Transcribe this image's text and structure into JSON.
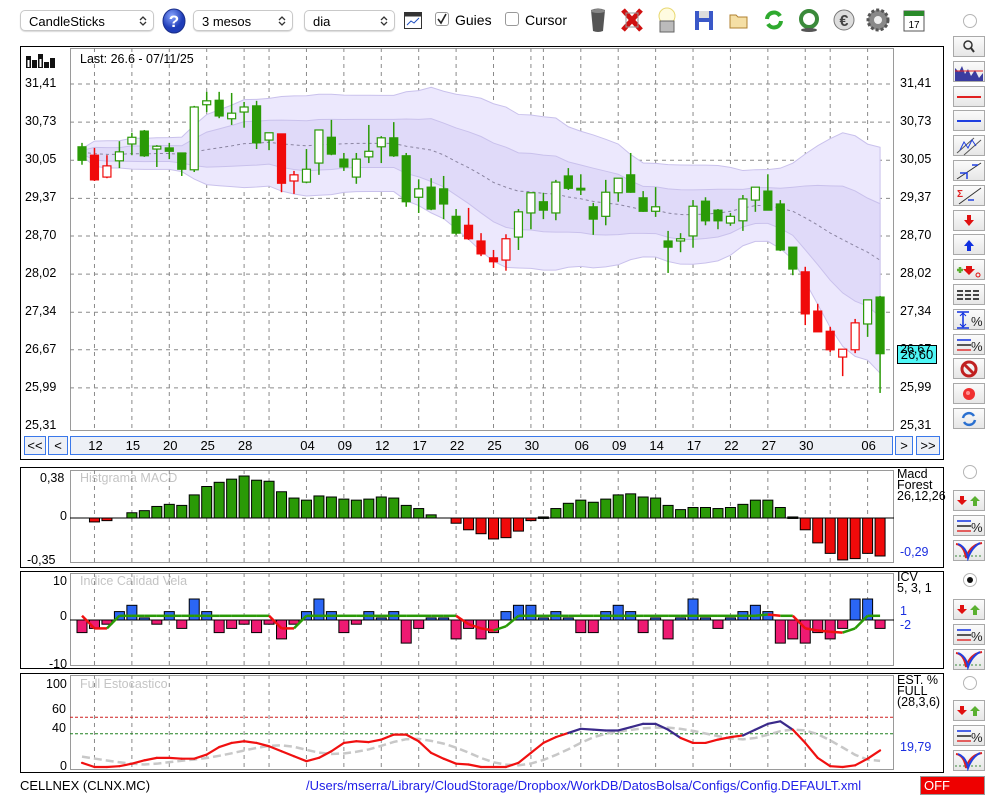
{
  "toolbar": {
    "chart_type": "CandleSticks",
    "period": "3 mesos",
    "interval": "dia",
    "guides_label": "Guies",
    "guides_checked": true,
    "cursor_label": "Cursor",
    "cursor_checked": false,
    "icons": [
      "trash-icon",
      "delete-x-icon",
      "lamp-icon",
      "save-icon",
      "folder-open-icon",
      "refresh-icon",
      "recycle-icon",
      "euro-icon",
      "gear-icon",
      "calendar-icon"
    ],
    "calendar_day": "17"
  },
  "main": {
    "last_label": "Last: 26.6 - 07/11/25",
    "price_labels": [
      "31,41",
      "30,73",
      "30,05",
      "29,37",
      "28,70",
      "28,02",
      "27,34",
      "26,67",
      "25,99",
      "25,31"
    ],
    "price_values": [
      31.41,
      30.73,
      30.05,
      29.37,
      28.7,
      28.02,
      27.34,
      26.67,
      25.99,
      25.31
    ],
    "current_price": "26,60",
    "current_price_value": 26.6,
    "current_price_color": "#4ff7f7",
    "nav": {
      "first": "<<",
      "prev": "<",
      "next": ">",
      "last": ">>"
    },
    "date_ticks": [
      {
        "i": 1,
        "label": "12"
      },
      {
        "i": 4,
        "label": "15"
      },
      {
        "i": 7,
        "label": "20"
      },
      {
        "i": 10,
        "label": "25"
      },
      {
        "i": 13,
        "label": "28"
      },
      {
        "i": 18,
        "label": "04"
      },
      {
        "i": 21,
        "label": "09"
      },
      {
        "i": 24,
        "label": "12"
      },
      {
        "i": 27,
        "label": "17"
      },
      {
        "i": 30,
        "label": "22"
      },
      {
        "i": 33,
        "label": "25"
      },
      {
        "i": 36,
        "label": "30"
      },
      {
        "i": 40,
        "label": "06"
      },
      {
        "i": 43,
        "label": "09"
      },
      {
        "i": 46,
        "label": "14"
      },
      {
        "i": 49,
        "label": "17"
      },
      {
        "i": 52,
        "label": "22"
      },
      {
        "i": 55,
        "label": "27"
      },
      {
        "i": 58,
        "label": "30"
      },
      {
        "i": 63,
        "label": "06"
      }
    ],
    "month_starts": [
      15,
      37,
      60
    ]
  },
  "chart_data": [
    {
      "type": "candlestick",
      "title": "CELLNEX (CLNX.MC)",
      "ylim": [
        25.31,
        31.41
      ],
      "up_color": "#2a9a06",
      "down_color": "#f00a0a",
      "candles_ohlc_color": [
        [
          30.29,
          30.36,
          29.97,
          30.05,
          "g"
        ],
        [
          30.14,
          30.27,
          29.68,
          29.7,
          "r"
        ],
        [
          29.75,
          30.14,
          29.73,
          29.95,
          "r"
        ],
        [
          30.04,
          30.39,
          29.91,
          30.2,
          "g"
        ],
        [
          30.34,
          30.54,
          30.14,
          30.46,
          "g"
        ],
        [
          30.57,
          30.59,
          30.11,
          30.13,
          "g"
        ],
        [
          30.25,
          30.32,
          29.93,
          30.3,
          "g"
        ],
        [
          30.27,
          30.36,
          30.07,
          30.21,
          "g"
        ],
        [
          30.18,
          30.18,
          29.77,
          29.89,
          "g"
        ],
        [
          29.88,
          31.02,
          29.84,
          31.0,
          "g"
        ],
        [
          31.04,
          31.27,
          30.91,
          31.11,
          "g"
        ],
        [
          31.12,
          31.27,
          30.8,
          30.84,
          "g"
        ],
        [
          30.79,
          31.25,
          30.68,
          30.89,
          "g"
        ],
        [
          30.91,
          31.09,
          30.63,
          31.0,
          "g"
        ],
        [
          31.02,
          31.11,
          30.25,
          30.36,
          "g"
        ],
        [
          30.41,
          30.54,
          30.23,
          30.54,
          "g"
        ],
        [
          30.52,
          30.52,
          29.48,
          29.64,
          "r"
        ],
        [
          29.68,
          29.86,
          29.45,
          29.79,
          "r"
        ],
        [
          29.66,
          30.25,
          29.64,
          29.89,
          "g"
        ],
        [
          30.0,
          30.59,
          29.79,
          30.59,
          "g"
        ],
        [
          30.46,
          30.77,
          30.14,
          30.16,
          "g"
        ],
        [
          30.07,
          30.18,
          29.86,
          29.93,
          "g"
        ],
        [
          29.75,
          30.18,
          29.63,
          30.07,
          "g"
        ],
        [
          30.11,
          30.68,
          30.0,
          30.21,
          "g"
        ],
        [
          30.29,
          30.48,
          30.0,
          30.45,
          "g"
        ],
        [
          30.45,
          30.73,
          30.11,
          30.13,
          "g"
        ],
        [
          30.13,
          30.18,
          29.22,
          29.31,
          "g"
        ],
        [
          29.39,
          29.71,
          29.11,
          29.54,
          "g"
        ],
        [
          29.57,
          29.73,
          29.16,
          29.18,
          "g"
        ],
        [
          29.54,
          29.77,
          29.0,
          29.27,
          "g"
        ],
        [
          29.05,
          29.18,
          28.72,
          28.75,
          "g"
        ],
        [
          28.89,
          29.2,
          28.63,
          28.65,
          "r"
        ],
        [
          28.61,
          28.75,
          28.34,
          28.38,
          "r"
        ],
        [
          28.31,
          28.45,
          28.13,
          28.24,
          "r"
        ],
        [
          28.27,
          28.73,
          28.08,
          28.65,
          "r"
        ],
        [
          28.68,
          29.18,
          28.45,
          29.13,
          "g"
        ],
        [
          29.11,
          29.47,
          28.82,
          29.47,
          "g"
        ],
        [
          29.31,
          29.47,
          29.0,
          29.16,
          "g"
        ],
        [
          29.11,
          29.7,
          28.98,
          29.66,
          "g"
        ],
        [
          29.77,
          29.91,
          29.52,
          29.55,
          "g"
        ],
        [
          29.55,
          29.8,
          29.43,
          29.52,
          "g"
        ],
        [
          29.22,
          29.29,
          28.72,
          29.0,
          "g"
        ],
        [
          29.05,
          29.7,
          28.89,
          29.48,
          "g"
        ],
        [
          29.47,
          29.73,
          29.31,
          29.73,
          "g"
        ],
        [
          29.79,
          30.18,
          29.47,
          29.48,
          "g"
        ],
        [
          29.38,
          29.5,
          29.13,
          29.14,
          "g"
        ],
        [
          29.14,
          29.57,
          29.04,
          29.22,
          "g"
        ],
        [
          28.61,
          28.79,
          28.04,
          28.5,
          "g"
        ],
        [
          28.61,
          28.75,
          28.41,
          28.65,
          "g"
        ],
        [
          28.7,
          29.34,
          28.49,
          29.23,
          "g"
        ],
        [
          29.32,
          29.39,
          28.89,
          28.97,
          "g"
        ],
        [
          29.16,
          29.18,
          28.82,
          28.97,
          "g"
        ],
        [
          28.93,
          29.11,
          28.88,
          29.05,
          "g"
        ],
        [
          28.97,
          29.43,
          28.79,
          29.36,
          "g"
        ],
        [
          29.34,
          29.57,
          29.13,
          29.57,
          "g"
        ],
        [
          29.5,
          29.8,
          29.16,
          29.16,
          "g"
        ],
        [
          29.27,
          29.34,
          28.43,
          28.45,
          "g"
        ],
        [
          28.5,
          28.5,
          28.0,
          28.11,
          "g"
        ],
        [
          28.06,
          28.15,
          27.11,
          27.31,
          "r"
        ],
        [
          27.36,
          27.49,
          26.99,
          26.99,
          "r"
        ],
        [
          27.0,
          27.08,
          26.63,
          26.67,
          "r"
        ],
        [
          26.54,
          26.68,
          26.2,
          26.68,
          "r"
        ],
        [
          26.67,
          27.22,
          26.61,
          27.15,
          "r"
        ],
        [
          27.13,
          27.56,
          26.9,
          27.56,
          "g"
        ],
        [
          27.61,
          27.63,
          25.9,
          26.6,
          "g"
        ]
      ]
    },
    {
      "type": "bar",
      "title": "Histgrama MACD",
      "axis_labels": [
        "0,38",
        "0",
        "-0,35"
      ],
      "legend": [
        "Macd",
        "Forest",
        "26,12,26"
      ],
      "last_value": "-0,29",
      "pos_color": "#2a9a06",
      "neg_color": "#f00a0a",
      "values": [
        0,
        -0.03,
        -0.02,
        0,
        0.05,
        0.07,
        0.11,
        0.13,
        0.12,
        0.22,
        0.3,
        0.34,
        0.37,
        0.4,
        0.36,
        0.35,
        0.25,
        0.19,
        0.17,
        0.21,
        0.2,
        0.18,
        0.17,
        0.18,
        0.2,
        0.19,
        0.12,
        0.09,
        0.03,
        0,
        -0.04,
        -0.09,
        -0.12,
        -0.16,
        -0.15,
        -0.1,
        -0.02,
        0.01,
        0.09,
        0.14,
        0.17,
        0.15,
        0.18,
        0.22,
        0.23,
        0.2,
        0.19,
        0.12,
        0.08,
        0.1,
        0.1,
        0.09,
        0.1,
        0.13,
        0.17,
        0.17,
        0.1,
        0.01,
        -0.09,
        -0.19,
        -0.27,
        -0.32,
        -0.31,
        -0.27,
        -0.29
      ]
    },
    {
      "type": "bar",
      "title": "Indice Calidad Vela",
      "axis_labels": [
        "10",
        "0",
        "-10"
      ],
      "ylim": [
        -10,
        10
      ],
      "legend": [
        "ICV",
        "5, 3, 1"
      ],
      "line_value": "1",
      "signal_value": "-2",
      "pos_color": "#2b66f5",
      "neg_color": "#ee1a72",
      "values": [
        -3,
        -2,
        -1,
        2,
        3.5,
        0.5,
        -1,
        2,
        -2,
        5,
        2,
        -3,
        -2,
        -1,
        -3,
        -1,
        -4.5,
        -1,
        2,
        5,
        2,
        -3,
        -1,
        2,
        0.5,
        2,
        -5.5,
        -2,
        0.5,
        0.5,
        -4.5,
        -2,
        -4.5,
        -3,
        2,
        3.5,
        3.5,
        0.5,
        2,
        0.5,
        -3,
        -3,
        2,
        3.5,
        2,
        -3,
        0.5,
        -4.5,
        0.5,
        5,
        0.5,
        -2,
        0.5,
        2,
        3.5,
        2,
        -5.5,
        -4.5,
        -5.5,
        -3,
        -4.5,
        -2,
        5,
        5,
        -2
      ],
      "line": [
        1,
        -2,
        -2,
        1,
        1,
        1,
        1,
        1,
        1,
        1,
        1,
        1,
        1,
        1,
        1,
        1,
        -2,
        -2,
        1,
        1,
        1,
        1,
        1,
        1,
        1,
        1,
        1,
        1,
        1,
        1,
        1,
        -1,
        -2,
        -2.5,
        -1.5,
        1,
        1,
        1,
        1,
        1,
        1,
        1,
        1,
        1,
        1,
        1,
        1,
        1,
        1,
        1,
        1,
        1,
        1,
        1,
        1,
        1.3,
        1,
        1,
        -2,
        -2.5,
        -2.8,
        -3,
        -2,
        1,
        1
      ]
    },
    {
      "type": "line",
      "title": "Full Estocastico",
      "axis_labels": [
        "100",
        "60",
        "40",
        "0"
      ],
      "ylim": [
        0,
        100
      ],
      "levels": [
        60,
        40
      ],
      "legend": [
        "EST. %",
        "FULL",
        "(28,3,6)"
      ],
      "last_value": "19,79",
      "k_color_low": "#f01010",
      "k_color_high": "#3a2a8a",
      "d_color": "#c8c8c8",
      "k": [
        5,
        0,
        0,
        1,
        4,
        8,
        11,
        11,
        10,
        10,
        15,
        24,
        29,
        31,
        29,
        25,
        19,
        13,
        7,
        11,
        19,
        29,
        31,
        30,
        33,
        39,
        39,
        31,
        17,
        10,
        4,
        3,
        0,
        0,
        0,
        5,
        17,
        29,
        36,
        41,
        46,
        45,
        44,
        44,
        48,
        52,
        52,
        45,
        35,
        29,
        29,
        33,
        36,
        38,
        45,
        52,
        55,
        45,
        29,
        11,
        1,
        0,
        2,
        10,
        20
      ]
    }
  ],
  "sidebar": {
    "main_buttons": [
      "zoom-icon",
      "mini-chart-icon",
      "red-line-icon",
      "blue-line-icon",
      "channel-icon",
      "trend-line-icon",
      "sigma-trend-icon",
      "red-arrow-down-icon",
      "blue-arrow-up-icon",
      "add-alert-icon",
      "dashed-lines-icon",
      "range-percent-icon",
      "lines-percent-icon",
      "no-entry-icon",
      "record-icon",
      "sync-icon"
    ],
    "indicator_buttons": [
      "arrows-down-up-icon",
      "lines-percent-icon",
      "curves-icon"
    ],
    "radio_selected": 2
  },
  "footer": {
    "symbol": "CELLNEX (CLNX.MC)",
    "config_path": "/Users/mserra/Library/CloudStorage/Dropbox/WorkDB/DatosBolsa/Configs/Config.DEFAULT.xml",
    "status": "OFF",
    "status_color": "#ee0000"
  }
}
